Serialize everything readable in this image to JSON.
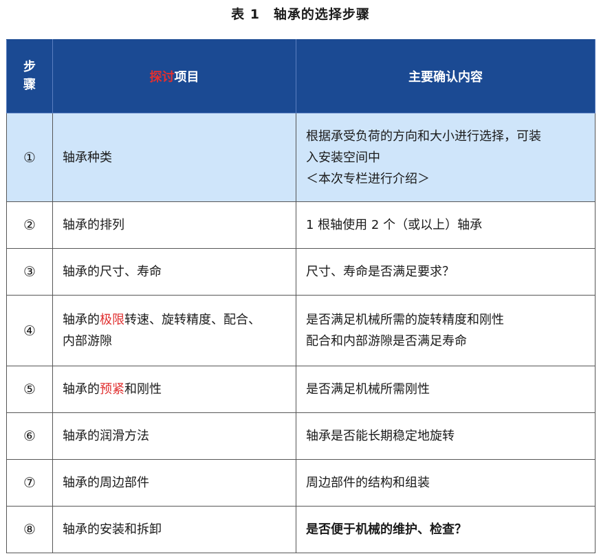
{
  "title": "表 1　轴承的选择步骤",
  "header": {
    "step_line1": "步",
    "step_line2": "骤",
    "item_red": "探讨",
    "item_rest": "项目",
    "content": "主要确认内容"
  },
  "rows": [
    {
      "num": "①",
      "item": [
        {
          "t": "轴承种类",
          "red": false
        }
      ],
      "content": [
        "根据承受负荷的方向和大小进行选择，可装",
        "入安装空间中",
        "＜本次专栏进行介绍＞"
      ]
    },
    {
      "num": "②",
      "item": [
        {
          "t": "轴承的排列",
          "red": false
        }
      ],
      "content": [
        "1 根轴使用 2 个（或以上）轴承"
      ]
    },
    {
      "num": "③",
      "item": [
        {
          "t": "轴承的尺寸、寿命",
          "red": false
        }
      ],
      "content": [
        "尺寸、寿命是否满足要求？"
      ]
    },
    {
      "num": "④",
      "item": [
        {
          "t": "轴承的",
          "red": false
        },
        {
          "t": "极限",
          "red": true
        },
        {
          "t": "转速、旋转精度、配合、\n内部游隙",
          "red": false
        }
      ],
      "content": [
        "是否满足机械所需的旋转精度和刚性",
        "配合和内部游隙是否满足寿命"
      ]
    },
    {
      "num": "⑤",
      "item": [
        {
          "t": "轴承的",
          "red": false
        },
        {
          "t": "预紧",
          "red": true
        },
        {
          "t": "和刚性",
          "red": false
        }
      ],
      "content": [
        "是否满足机械所需刚性"
      ]
    },
    {
      "num": "⑥",
      "item": [
        {
          "t": "轴承的润滑方法",
          "red": false
        }
      ],
      "content": [
        "轴承是否能长期稳定地旋转"
      ]
    },
    {
      "num": "⑦",
      "item": [
        {
          "t": "轴承的周边部件",
          "red": false
        }
      ],
      "content": [
        "周边部件的结构和组装"
      ]
    },
    {
      "num": "⑧",
      "item": [
        {
          "t": "轴承的安装和拆卸",
          "red": false
        }
      ],
      "content": [
        "是否便于机械的维护、检查？"
      ]
    }
  ],
  "colors": {
    "header_bg": "#1b4a93",
    "highlight_row_bg": "#cfe5fa",
    "red_text": "#e03030"
  }
}
